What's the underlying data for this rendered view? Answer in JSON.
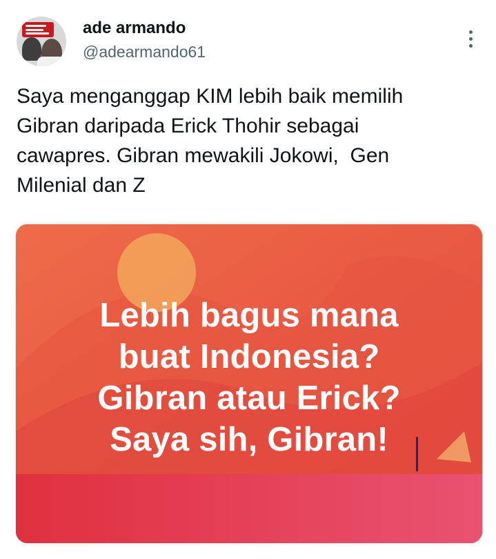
{
  "author": {
    "name": "ade armando",
    "handle": "@adearmando61"
  },
  "tweet": {
    "text": "Saya menganggap KIM lebih baik memilih\nGibran daripada Erick Thohir sebagai\ncawapres. Gibran mewakili Jokowi,  Gen\nMilenial dan Z"
  },
  "media": {
    "lines": [
      "Lebih bagus mana",
      "buat Indonesia?",
      "Gibran atau Erick?",
      "Saya sih, Gibran!"
    ],
    "colors": {
      "background": "#ea5a43",
      "sun": "#f3a25a",
      "band": "#e43a55",
      "text": "#ffffff"
    }
  },
  "icons": {
    "more": "more-vertical-icon"
  }
}
